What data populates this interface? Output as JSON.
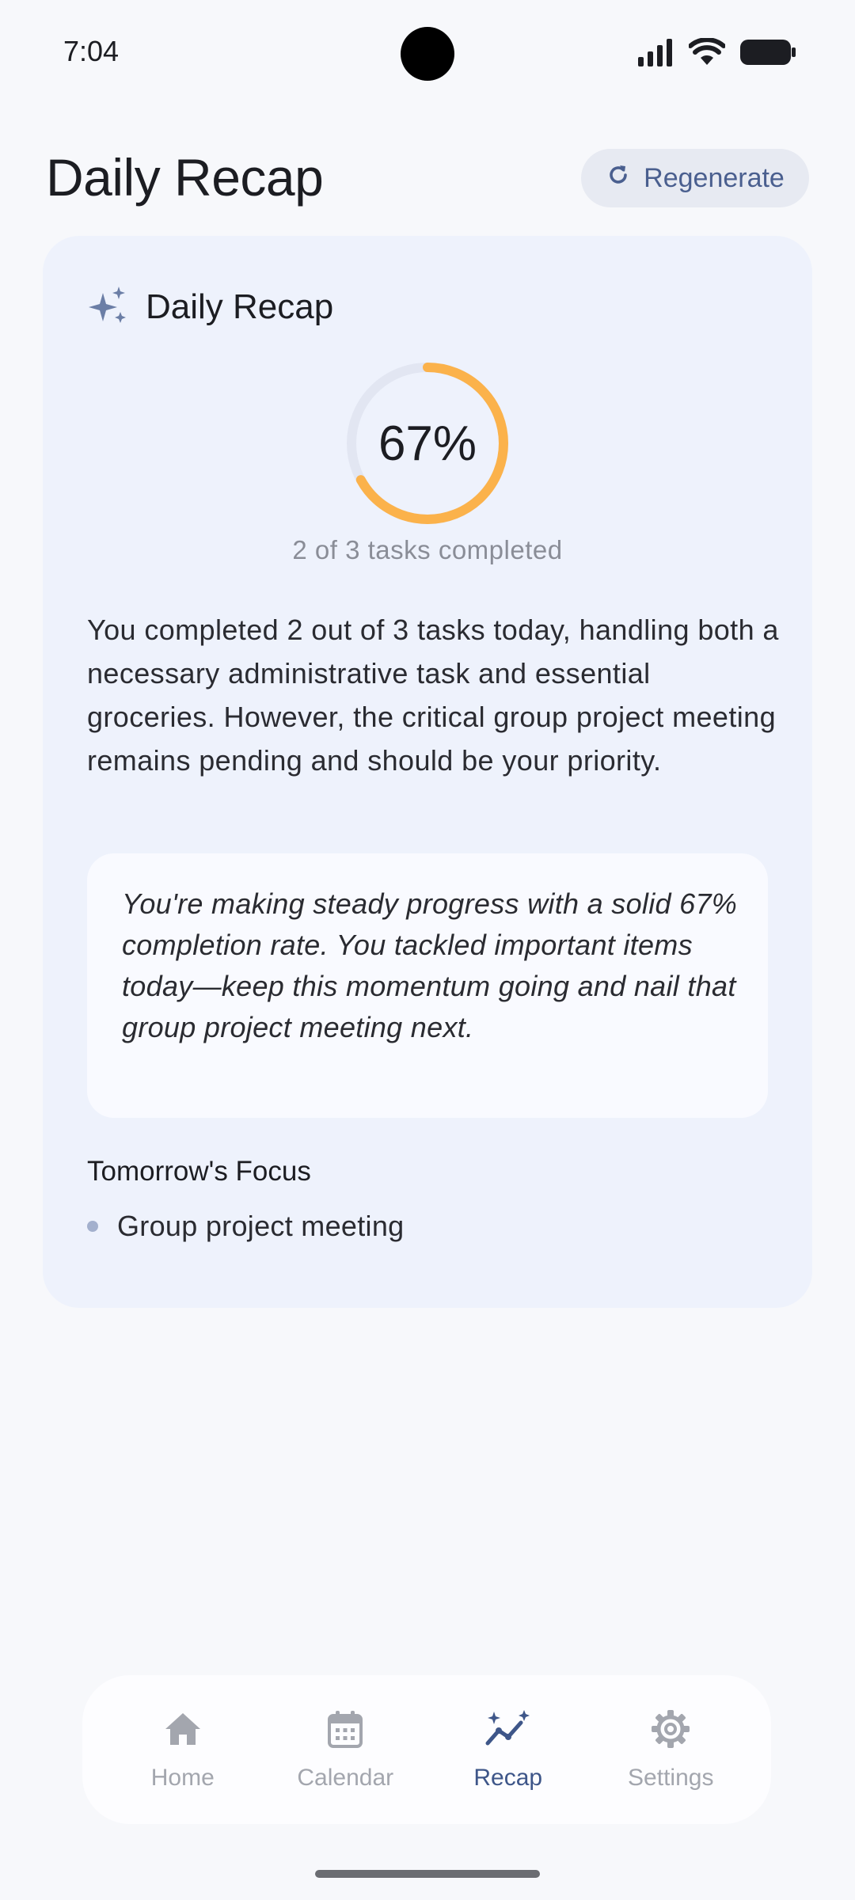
{
  "status_bar": {
    "time": "7:04"
  },
  "header": {
    "title": "Daily Recap",
    "regenerate_label": "Regenerate"
  },
  "card": {
    "title": "Daily Recap",
    "progress": {
      "percent_label": "67%",
      "fraction": 0.67,
      "caption": "2 of 3 tasks completed"
    },
    "summary": "You completed 2 out of 3 tasks today, handling both a necessary administrative task and essential groceries. However, the critical group project meeting remains pending and should be your priority.",
    "quote": "You're making steady progress with a solid 67% completion rate. You tackled important items today—keep this momentum going and nail that group project meeting next.",
    "focus_heading": "Tomorrow's Focus",
    "focus_items": [
      "Group project meeting"
    ]
  },
  "nav": {
    "items": [
      {
        "label": "Home",
        "icon": "home-icon"
      },
      {
        "label": "Calendar",
        "icon": "calendar-icon"
      },
      {
        "label": "Recap",
        "icon": "recap-icon",
        "active": true
      },
      {
        "label": "Settings",
        "icon": "settings-icon"
      }
    ]
  },
  "colors": {
    "accent": "#3e5689",
    "progress": "#fbb24b",
    "ring_track": "#e2e6f2",
    "card_bg": "#eef2fc"
  }
}
